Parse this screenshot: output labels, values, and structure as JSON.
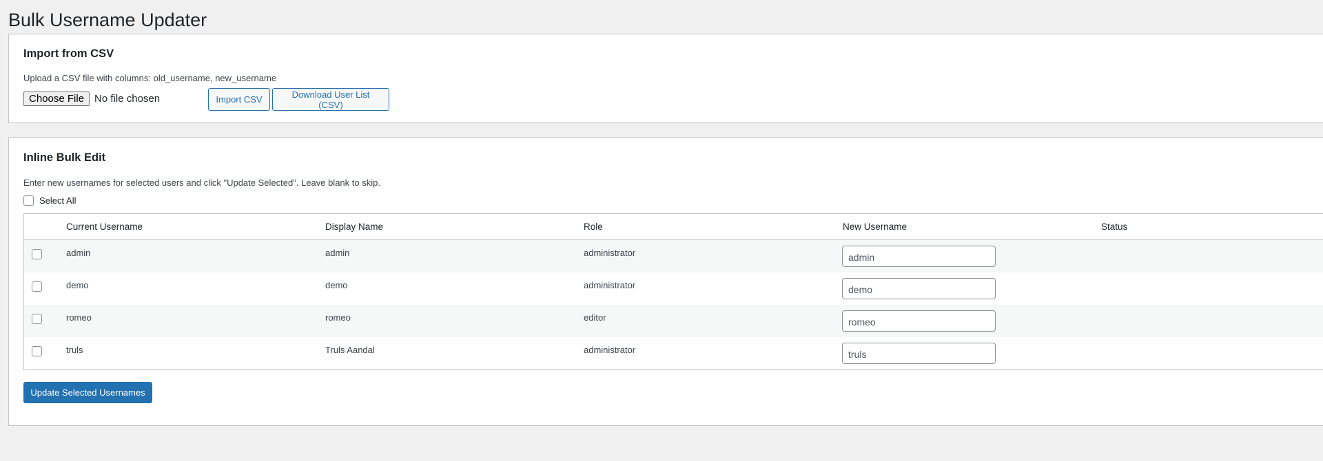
{
  "page": {
    "title": "Bulk Username Updater"
  },
  "import_section": {
    "title": "Import from CSV",
    "description": "Upload a CSV file with columns: old_username, new_username",
    "choose_file_label": "Choose File",
    "file_status": "No file chosen",
    "import_button": "Import CSV",
    "download_button": "Download User List (CSV)"
  },
  "inline_section": {
    "title": "Inline Bulk Edit",
    "description": "Enter new usernames for selected users and click \"Update Selected\". Leave blank to skip.",
    "select_all_label": "Select All",
    "columns": [
      "Current Username",
      "Display Name",
      "Role",
      "New Username",
      "Status"
    ],
    "rows": [
      {
        "current": "admin",
        "display": "admin",
        "role": "administrator",
        "new": "admin",
        "status": ""
      },
      {
        "current": "demo",
        "display": "demo",
        "role": "administrator",
        "new": "demo",
        "status": ""
      },
      {
        "current": "romeo",
        "display": "romeo",
        "role": "editor",
        "new": "romeo",
        "status": ""
      },
      {
        "current": "truls",
        "display": "Truls Aandal",
        "role": "administrator",
        "new": "truls",
        "status": ""
      }
    ],
    "update_button": "Update Selected Usernames"
  },
  "colors": {
    "primary": "#2271b1",
    "background": "#f0f0f1",
    "border": "#c3c4c7"
  }
}
